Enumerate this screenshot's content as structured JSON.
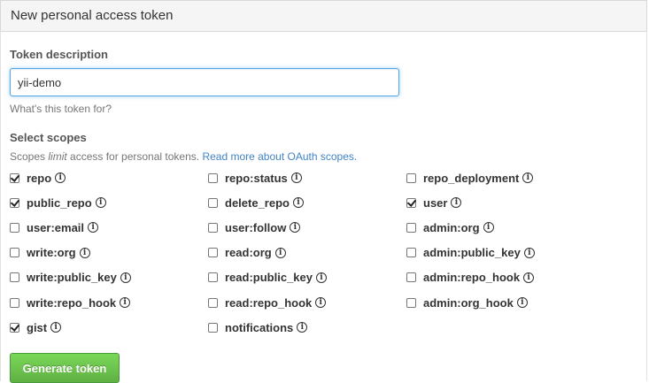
{
  "panel": {
    "title": "New personal access token"
  },
  "form": {
    "description_label": "Token description",
    "description_value": "yii-demo",
    "description_hint": "What's this token for?",
    "scopes_label": "Select scopes",
    "scopes_note_before": "Scopes ",
    "scopes_note_em": "limit",
    "scopes_note_after": " access for personal tokens. ",
    "scopes_note_link": "Read more about OAuth scopes.",
    "submit_label": "Generate token",
    "submit_color": "#60b044",
    "link_color": "#4183c4",
    "focus_color": "#51a7e8"
  },
  "scopes": [
    {
      "label": "repo",
      "checked": true
    },
    {
      "label": "repo:status",
      "checked": false
    },
    {
      "label": "repo_deployment",
      "checked": false
    },
    {
      "label": "public_repo",
      "checked": true
    },
    {
      "label": "delete_repo",
      "checked": false
    },
    {
      "label": "user",
      "checked": true
    },
    {
      "label": "user:email",
      "checked": false
    },
    {
      "label": "user:follow",
      "checked": false
    },
    {
      "label": "admin:org",
      "checked": false
    },
    {
      "label": "write:org",
      "checked": false
    },
    {
      "label": "read:org",
      "checked": false
    },
    {
      "label": "admin:public_key",
      "checked": false
    },
    {
      "label": "write:public_key",
      "checked": false
    },
    {
      "label": "read:public_key",
      "checked": false
    },
    {
      "label": "admin:repo_hook",
      "checked": false
    },
    {
      "label": "write:repo_hook",
      "checked": false
    },
    {
      "label": "read:repo_hook",
      "checked": false
    },
    {
      "label": "admin:org_hook",
      "checked": false
    },
    {
      "label": "gist",
      "checked": true
    },
    {
      "label": "notifications",
      "checked": false
    }
  ]
}
